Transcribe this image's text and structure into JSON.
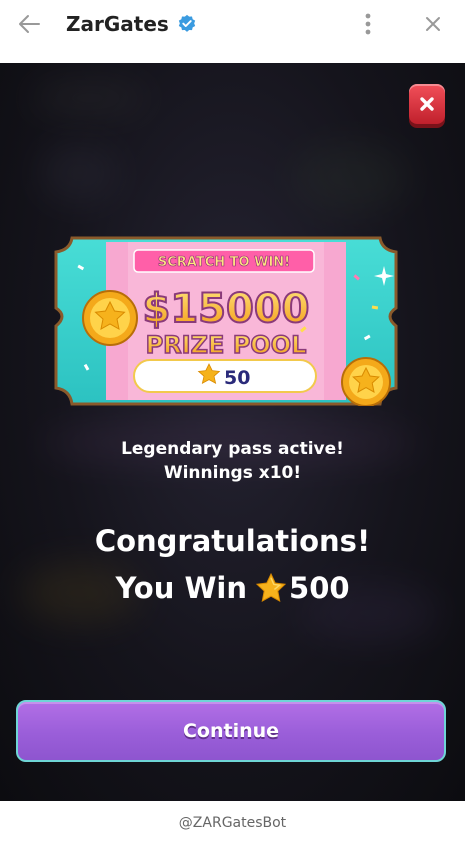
{
  "topbar": {
    "title": "ZarGates"
  },
  "icons": {
    "back": "arrow-left-icon",
    "verified": "verified-badge-icon",
    "more": "vertical-dots-icon",
    "close": "close-icon",
    "dialog_close": "red-close-icon",
    "star": "star-icon",
    "coin": "gold-star-coin-icon"
  },
  "ticket": {
    "headline": "SCRATCH TO WIN!",
    "amount": "$15000",
    "subtitle": "PRIZE POOL",
    "cost": "50"
  },
  "message": {
    "line1": "Legendary pass active!",
    "line2": "Winnings x10!",
    "congrats": "Congratulations!",
    "win_prefix": "You Win",
    "win_amount": "500"
  },
  "buttons": {
    "continue": "Continue"
  },
  "footer": {
    "bot_handle": "@ZARGatesBot"
  },
  "colors": {
    "accent_purple": "#9a5ed9",
    "accent_teal": "#6fd5d6",
    "ticket_teal": "#3fd3cf",
    "ticket_pink": "#f7a8d0",
    "gold": "#f5b21b",
    "verified_blue": "#3a9be0",
    "close_red": "#e23a44"
  }
}
